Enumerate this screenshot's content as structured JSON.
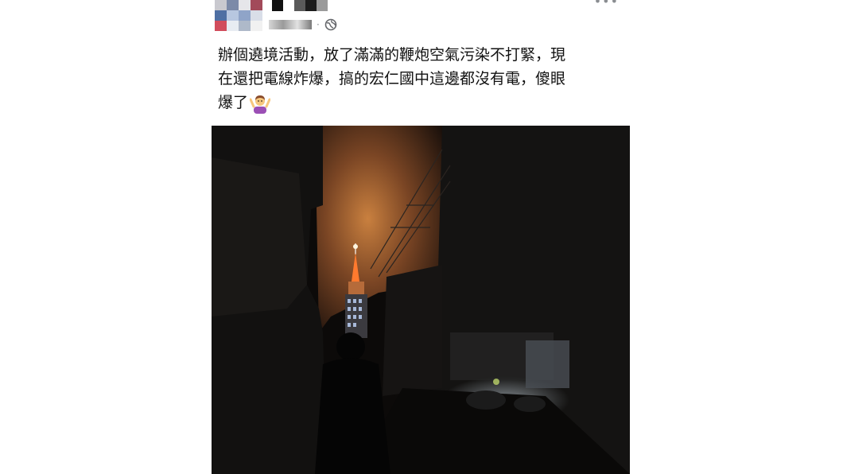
{
  "post": {
    "text_lines": [
      "辦個遶境活動，放了滿滿的鞭炮空氣污染不打緊，現",
      "在還把電線炸爆，搞的宏仁國中這邊都沒有電，傻眼",
      "爆了"
    ],
    "separator": "·",
    "privacy_icon": "globe-icon",
    "emoji_icon": "person-shrugging-emoji",
    "more_icon": "ellipsis-icon"
  },
  "colors": {
    "text": "#111111",
    "meta": "#8a8d91",
    "sky_glow": "#c87a3a",
    "tower_light": "#ff8a3a"
  }
}
